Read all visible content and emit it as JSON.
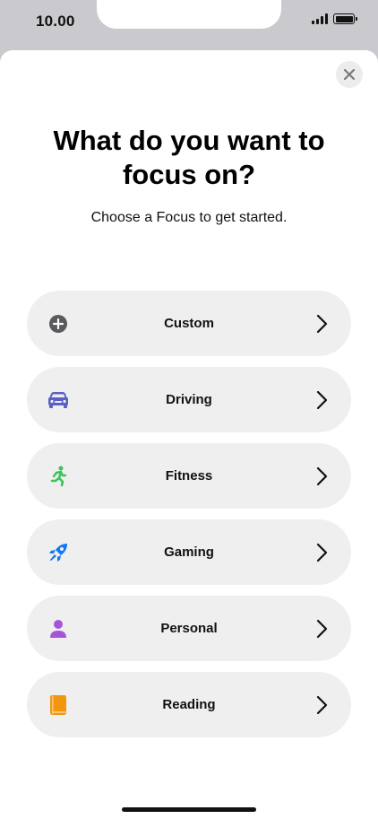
{
  "status_bar": {
    "time": "10.00"
  },
  "sheet": {
    "title": "What do you want to focus on?",
    "subtitle": "Choose a Focus to get started."
  },
  "options": [
    {
      "label": "Custom",
      "icon": "plus-circle-icon",
      "color": "#5a5a5e"
    },
    {
      "label": "Driving",
      "icon": "car-icon",
      "color": "#5b5fc7"
    },
    {
      "label": "Fitness",
      "icon": "running-icon",
      "color": "#3bc45a"
    },
    {
      "label": "Gaming",
      "icon": "rocket-icon",
      "color": "#1478f0"
    },
    {
      "label": "Personal",
      "icon": "person-icon",
      "color": "#a455d8"
    },
    {
      "label": "Reading",
      "icon": "book-icon",
      "color": "#f2960f"
    }
  ]
}
